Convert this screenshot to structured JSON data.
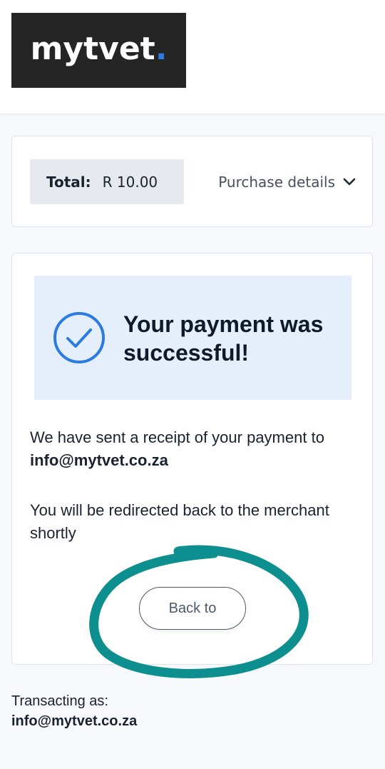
{
  "header": {
    "logo_text": "mytvet",
    "logo_dot": "."
  },
  "order": {
    "total_label": "Total:",
    "total_value": "R 10.00",
    "purchase_details_label": "Purchase details"
  },
  "status": {
    "title": "Your payment was successful!",
    "receipt_prefix": "We have sent a receipt of your payment to ",
    "receipt_email": "info@mytvet.co.za",
    "redirect_message": "You will be redirected back to the merchant shortly",
    "back_button_label": "Back to"
  },
  "footer": {
    "transacting_label": "Transacting as:",
    "email": "info@mytvet.co.za"
  },
  "colors": {
    "accent_blue": "#2b7be0",
    "success_bg": "#e4effb",
    "annotation_teal": "#0e8f8f"
  },
  "icons": {
    "success": "check-circle-icon",
    "purchase_details": "chevron-down-icon"
  }
}
